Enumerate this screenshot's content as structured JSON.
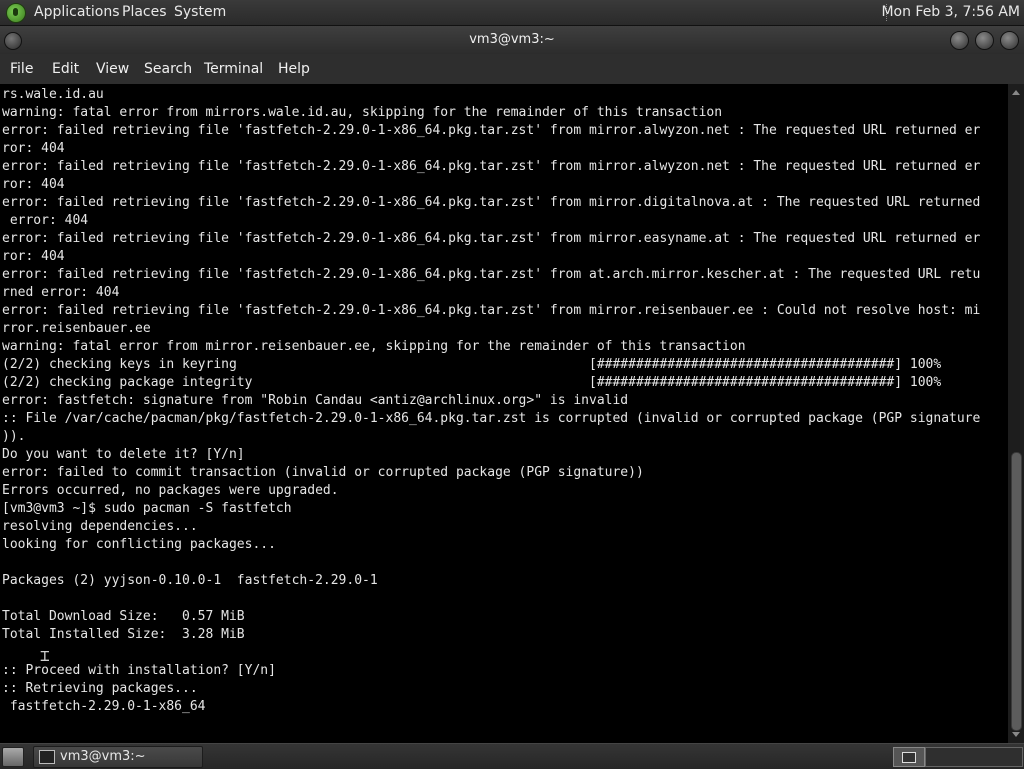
{
  "top_panel": {
    "menus": [
      "Applications",
      "Places",
      "System"
    ],
    "clock": "Mon Feb  3,  7:56 AM"
  },
  "window": {
    "title": "vm3@vm3:~",
    "menu": [
      "File",
      "Edit",
      "View",
      "Search",
      "Terminal",
      "Help"
    ]
  },
  "terminal": {
    "lines": [
      "rs.wale.id.au",
      "warning: fatal error from mirrors.wale.id.au, skipping for the remainder of this transaction",
      "error: failed retrieving file 'fastfetch-2.29.0-1-x86_64.pkg.tar.zst' from mirror.alwyzon.net : The requested URL returned er",
      "ror: 404",
      "error: failed retrieving file 'fastfetch-2.29.0-1-x86_64.pkg.tar.zst' from mirror.alwyzon.net : The requested URL returned er",
      "ror: 404",
      "error: failed retrieving file 'fastfetch-2.29.0-1-x86_64.pkg.tar.zst' from mirror.digitalnova.at : The requested URL returned",
      " error: 404",
      "error: failed retrieving file 'fastfetch-2.29.0-1-x86_64.pkg.tar.zst' from mirror.easyname.at : The requested URL returned er",
      "ror: 404",
      "error: failed retrieving file 'fastfetch-2.29.0-1-x86_64.pkg.tar.zst' from at.arch.mirror.kescher.at : The requested URL retu",
      "rned error: 404",
      "error: failed retrieving file 'fastfetch-2.29.0-1-x86_64.pkg.tar.zst' from mirror.reisenbauer.ee : Could not resolve host: mi",
      "rror.reisenbauer.ee",
      "warning: fatal error from mirror.reisenbauer.ee, skipping for the remainder of this transaction",
      "(2/2) checking keys in keyring                                             [######################################] 100%",
      "(2/2) checking package integrity                                           [######################################] 100%",
      "error: fastfetch: signature from \"Robin Candau <antiz@archlinux.org>\" is invalid",
      ":: File /var/cache/pacman/pkg/fastfetch-2.29.0-1-x86_64.pkg.tar.zst is corrupted (invalid or corrupted package (PGP signature",
      ")).",
      "Do you want to delete it? [Y/n]",
      "error: failed to commit transaction (invalid or corrupted package (PGP signature))",
      "Errors occurred, no packages were upgraded.",
      "[vm3@vm3 ~]$ sudo pacman -S fastfetch",
      "resolving dependencies...",
      "looking for conflicting packages...",
      "",
      "Packages (2) yyjson-0.10.0-1  fastfetch-2.29.0-1",
      "",
      "Total Download Size:   0.57 MiB",
      "Total Installed Size:  3.28 MiB",
      "",
      ":: Proceed with installation? [Y/n]",
      ":: Retrieving packages...",
      " fastfetch-2.29.0-1-x86_64"
    ]
  },
  "taskbar": {
    "items": [
      "vm3@vm3:~"
    ]
  },
  "icons": {
    "panel_logo": "gnome-foot-icon",
    "terminal_task": "terminal-icon",
    "show_desktop": "show-desktop-icon",
    "workspace": "workspace-switcher-icon",
    "text_cursor": "ibeam-cursor-icon"
  }
}
